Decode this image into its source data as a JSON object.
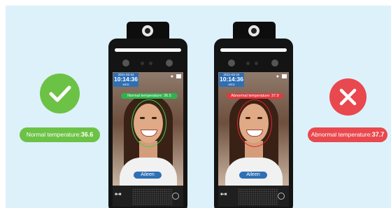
{
  "normal": {
    "label": "Normal temperature:",
    "value": "36.6",
    "status_color": "#6cc245",
    "icon": "check-icon"
  },
  "abnormal": {
    "label": "Abnormal temperature:",
    "value": "37.7",
    "status_color": "#e9484e",
    "icon": "cross-icon"
  },
  "device_normal": {
    "date": "2021-02-24",
    "time": "10:14:36",
    "weekday": "WED",
    "temp_text": "Normal temperature: 36.5",
    "name": "Aileen"
  },
  "device_abnormal": {
    "date": "2021-02-24",
    "time": "10:14:36",
    "weekday": "WED",
    "temp_text": "Abnormal temperature: 37.9",
    "name": "Aileen"
  }
}
